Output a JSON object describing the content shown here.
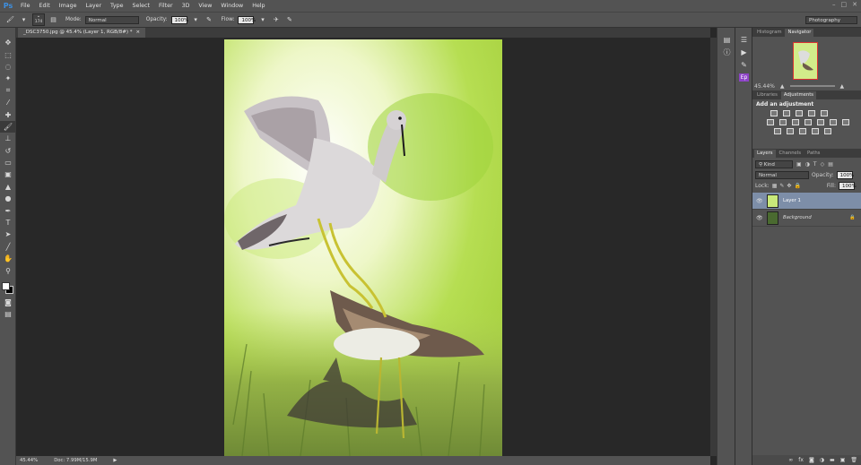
{
  "menubar": {
    "logo": "Ps",
    "items": [
      "File",
      "Edit",
      "Image",
      "Layer",
      "Type",
      "Select",
      "Filter",
      "3D",
      "View",
      "Window",
      "Help"
    ]
  },
  "options": {
    "brush_size": "174",
    "mode_label": "Mode:",
    "mode_value": "Normal",
    "opacity_label": "Opacity:",
    "opacity_value": "100%",
    "flow_label": "Flow:",
    "flow_value": "100%",
    "workspace": "Photography"
  },
  "document": {
    "tab_title": "_DSC3750.jpg @ 45.4% (Layer 1, RGB/8#) *",
    "tab_close": "×"
  },
  "status": {
    "zoom": "45.44%",
    "doc": "Doc: 7.99M/15.9M"
  },
  "panels": {
    "top_tabs": [
      "Histogram",
      "Navigator"
    ],
    "nav_zoom": "45.44%",
    "mid_tabs": [
      "Libraries",
      "Adjustments"
    ],
    "adjust_title": "Add an adjustment",
    "layer_tabs": [
      "Layers",
      "Channels",
      "Paths"
    ],
    "kind_label": "Kind",
    "blend_mode": "Normal",
    "opacity_label": "Opacity:",
    "opacity_value": "100%",
    "lock_label": "Lock:",
    "fill_label": "Fill:",
    "fill_value": "100%",
    "layers": [
      {
        "name": "Layer 1",
        "selected": true
      },
      {
        "name": "Background",
        "selected": false
      }
    ]
  },
  "colors": {
    "ui_bg": "#535353",
    "canvas_bg": "#282828",
    "selected_layer": "#7d8ea8",
    "ps_blue": "#3d8fe0",
    "ep_purple": "#8e44c8"
  }
}
